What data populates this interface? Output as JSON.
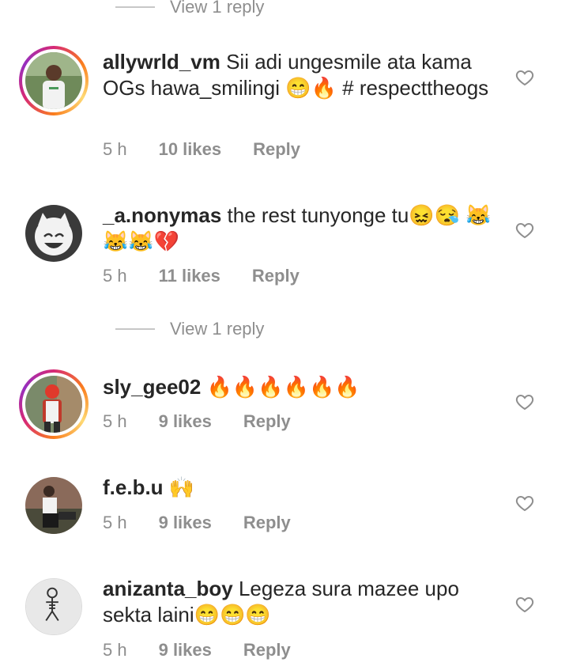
{
  "top_view_replies": "View 1 reply",
  "mid_view_replies": "View 1 reply",
  "comments": [
    {
      "username": "allywrld_vm",
      "text": "Sii adi ungesmile ata kama OGs hawa_smilingi 😁🔥 # respecttheogs",
      "time": "5 h",
      "likes": "10 likes",
      "reply": "Reply"
    },
    {
      "username": "_a.nonymas",
      "text": "the rest tunyonge tu😖😪 😹😹😹💔",
      "time": "5 h",
      "likes": "11 likes",
      "reply": "Reply"
    },
    {
      "username": "sly_gee02",
      "text": "🔥🔥🔥🔥🔥🔥",
      "time": "5 h",
      "likes": "9 likes",
      "reply": "Reply"
    },
    {
      "username": "f.e.b.u",
      "text": "🙌",
      "time": "5 h",
      "likes": "9 likes",
      "reply": "Reply"
    },
    {
      "username": "anizanta_boy",
      "text": "Legeza sura mazee upo sekta laini😁😁😁",
      "time": "5 h",
      "likes": "9 likes",
      "reply": "Reply"
    }
  ]
}
